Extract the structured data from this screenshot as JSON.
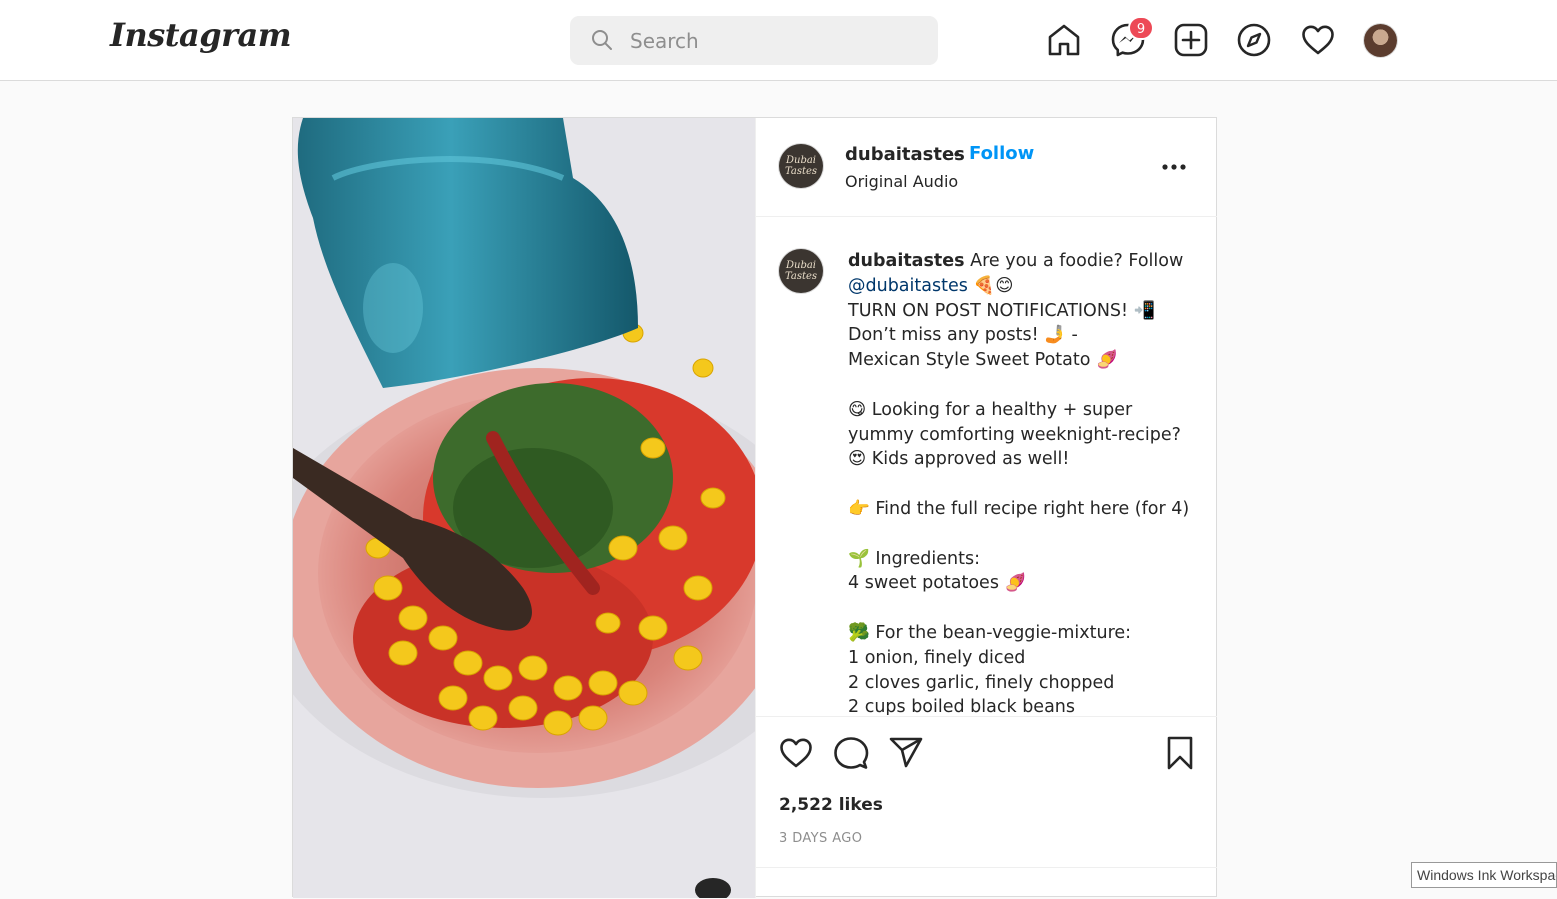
{
  "nav": {
    "logo": "Instagram",
    "search_placeholder": "Search",
    "messages_badge": "9"
  },
  "post": {
    "username": "dubaitastes",
    "separator": "•",
    "follow_label": "Follow",
    "audio": "Original Audio",
    "avatar_text": "Dubai Tastes",
    "caption": {
      "username": "dubaitastes",
      "first_line": " Are you a foodie? Follow ",
      "mention": "@dubaitastes",
      "after_mention": " 🍕😊\nTURN ON POST NOTIFICATIONS! 📲\nDon’t miss any posts! 🤳 -\nMexican Style Sweet Potato 🍠\n\n😋 Looking for a healthy + super yummy comforting weeknight-recipe?\n😍 Kids approved as well!\n\n👉 Find the full recipe right here (for 4)\n\n🌱 Ingredients:\n4 sweet potatoes 🍠\n\n🥦 For the bean-veggie-mixture:\n1 onion, finely diced\n2 cloves garlic, finely chopped\n2 cups boiled black beans"
    },
    "likes": "2,522 likes",
    "timestamp": "3 DAYS AGO"
  },
  "system": {
    "ink_workspace": "Windows Ink Workspace"
  },
  "colors": {
    "accent": "#0095f6",
    "badge": "#ed4956",
    "border": "#dbdbdb"
  }
}
